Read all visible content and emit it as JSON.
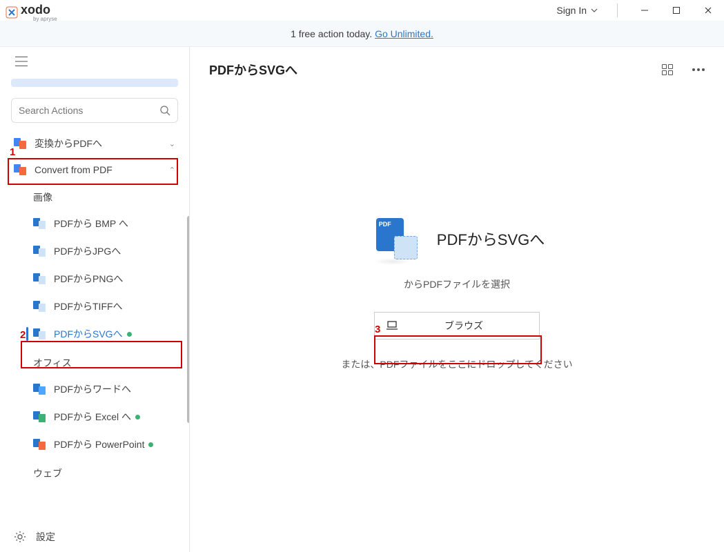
{
  "titlebar": {
    "brand": "xodo",
    "brand_sub": "by apryse",
    "signin": "Sign In"
  },
  "banner": {
    "text": "1 free action today. ",
    "link": "Go Unlimited."
  },
  "search": {
    "placeholder": "Search Actions"
  },
  "sidebar": {
    "groups": [
      {
        "label": "変換からPDFへ",
        "expanded": false
      },
      {
        "label": "Convert from PDF",
        "expanded": true
      }
    ],
    "subheaders": {
      "images": "画像",
      "office": "オフィス",
      "web": "ウェブ"
    },
    "items_images": [
      {
        "label": "PDFから BMP へ",
        "active": false,
        "dot": false
      },
      {
        "label": "PDFからJPGへ",
        "active": false,
        "dot": false
      },
      {
        "label": "PDFからPNGへ",
        "active": false,
        "dot": false
      },
      {
        "label": "PDFからTIFFへ",
        "active": false,
        "dot": false
      },
      {
        "label": "PDFからSVGへ",
        "active": true,
        "dot": true
      }
    ],
    "items_office": [
      {
        "label": "PDFからワードへ",
        "dot": false,
        "over_color": "#4da6ff"
      },
      {
        "label": "PDFから Excel へ",
        "dot": true,
        "over_color": "#3bb273"
      },
      {
        "label": "PDFから PowerPoint",
        "dot": true,
        "over_color": "#f26a3e"
      }
    ]
  },
  "footer": {
    "settings": "設定"
  },
  "content": {
    "title": "PDFからSVGへ",
    "hero_title": "PDFからSVGへ",
    "select_text": "からPDFファイルを選択",
    "browse": "ブラウズ",
    "drop_text": "または、PDFファイルをここにドロップしてください"
  },
  "annotations": {
    "a1": "1",
    "a2": "2",
    "a3": "3"
  }
}
